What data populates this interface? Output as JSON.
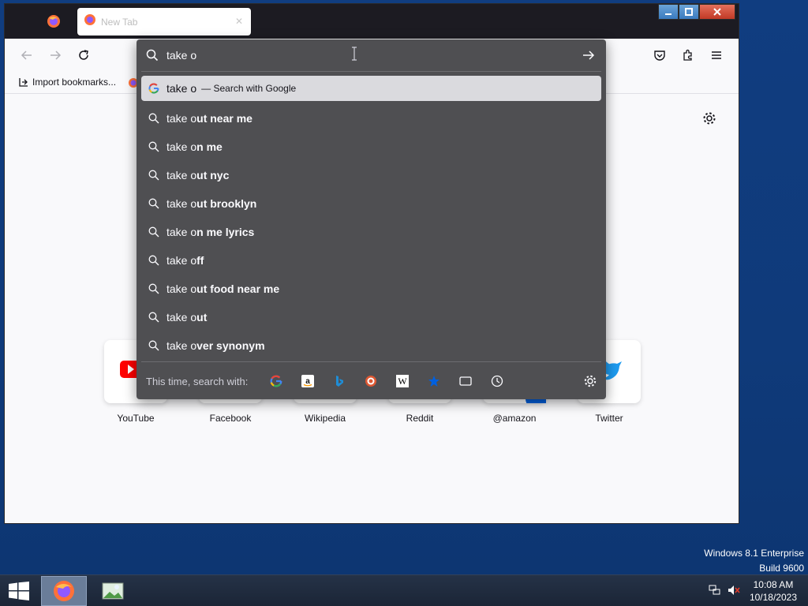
{
  "desktop": {
    "watermark_line1": "Windows 8.1 Enterprise",
    "watermark_line2": "Build 9600"
  },
  "browser": {
    "tab_title": "New Tab",
    "bookmarks": {
      "import_label": "Import bookmarks..."
    },
    "urlbar": {
      "value": "take o",
      "results": [
        {
          "typed": "take o",
          "rest": "",
          "action": "— Search with Google",
          "icon": "google-icon",
          "selected": true
        },
        {
          "typed": "take o",
          "rest": "ut near me"
        },
        {
          "typed": "take o",
          "rest": "n me"
        },
        {
          "typed": "take o",
          "rest": "ut nyc"
        },
        {
          "typed": "take o",
          "rest": "ut brooklyn"
        },
        {
          "typed": "take o",
          "rest": "n me lyrics"
        },
        {
          "typed": "take o",
          "rest": "ff"
        },
        {
          "typed": "take o",
          "rest": "ut food near me"
        },
        {
          "typed": "take o",
          "rest": "ut"
        },
        {
          "typed": "take o",
          "rest": "ver synonym"
        }
      ],
      "oneoff_label": "This time, search with:",
      "engines": [
        "google-icon",
        "amazon-icon",
        "bing-icon",
        "duckduckgo-icon",
        "wikipedia-icon",
        "bookmarks-star-icon",
        "tabs-icon",
        "history-icon"
      ]
    },
    "top_sites": [
      "YouTube",
      "Facebook",
      "Wikipedia",
      "Reddit",
      "@amazon",
      "Twitter"
    ]
  },
  "taskbar": {
    "time": "10:08 AM",
    "date": "10/18/2023"
  },
  "colors": {
    "desktop_bg": "#103d80",
    "dropdown_bg": "#4f4f52",
    "selected_row": "#dadade",
    "close_red": "#c13a26"
  }
}
